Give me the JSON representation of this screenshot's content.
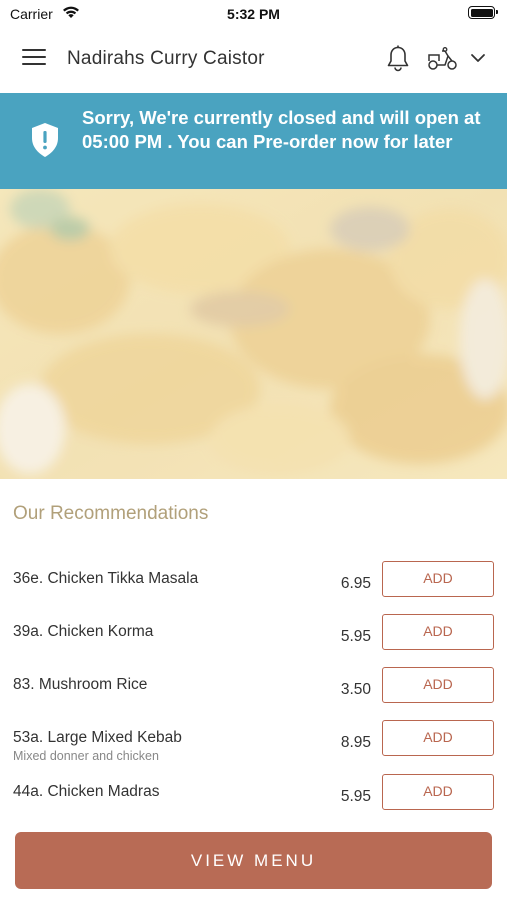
{
  "status_bar": {
    "carrier": "Carrier",
    "time": "5:32 PM"
  },
  "header": {
    "title": "Nadirahs Curry Caistor",
    "menu_icon": "hamburger-menu-icon",
    "notification_icon": "bell-icon",
    "delivery_icon": "scooter-icon",
    "dropdown_icon": "chevron-down-icon"
  },
  "banner": {
    "icon": "shield-alert-icon",
    "message": "Sorry, We're currently closed and will open at 05:00 PM . You can Pre-order now for later",
    "background_color": "#4aa3c0"
  },
  "recommendations": {
    "title": "Our Recommendations",
    "items": [
      {
        "name": "36e. Chicken Tikka Masala",
        "description": "",
        "price": "6.95",
        "button": "ADD"
      },
      {
        "name": "39a. Chicken Korma",
        "description": "",
        "price": "5.95",
        "button": "ADD"
      },
      {
        "name": "83. Mushroom Rice",
        "description": "",
        "price": "3.50",
        "button": "ADD"
      },
      {
        "name": "53a. Large Mixed Kebab",
        "description": "Mixed donner and chicken",
        "price": "8.95",
        "button": "ADD"
      },
      {
        "name": "44a. Chicken Madras",
        "description": "",
        "price": "5.95",
        "button": "ADD"
      }
    ]
  },
  "footer": {
    "view_menu_label": "VIEW MENU",
    "accent_color": "#b86b55"
  }
}
